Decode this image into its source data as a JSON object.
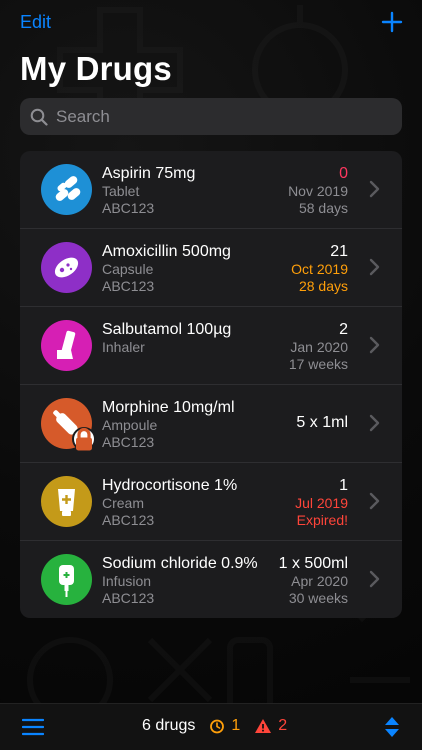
{
  "header": {
    "edit_label": "Edit",
    "title": "My Drugs"
  },
  "search": {
    "placeholder": "Search",
    "value": ""
  },
  "drugs": [
    {
      "name": "Aspirin 75mg",
      "form": "Tablet",
      "batch": "ABC123",
      "quantity": "0",
      "expiry": "Nov 2019",
      "time_left": "58 days",
      "color": "#1e90d6",
      "icon": "tablet-icon",
      "quantity_color": "#ff375f",
      "expiry_color": "#8e8e93",
      "time_left_color": "#8e8e93"
    },
    {
      "name": "Amoxicillin 500mg",
      "form": "Capsule",
      "batch": "ABC123",
      "quantity": "21",
      "expiry": "Oct 2019",
      "time_left": "28 days",
      "color": "#8e2fc7",
      "icon": "capsule-icon",
      "quantity_color": "#ffffff",
      "expiry_color": "#ff9f0a",
      "time_left_color": "#ff9f0a"
    },
    {
      "name": "Salbutamol 100µg",
      "form": "Inhaler",
      "batch": "",
      "quantity": "2",
      "expiry": "Jan 2020",
      "time_left": "17 weeks",
      "color": "#d61fb4",
      "icon": "inhaler-icon",
      "quantity_color": "#ffffff",
      "expiry_color": "#8e8e93",
      "time_left_color": "#8e8e93"
    },
    {
      "name": "Morphine 10mg/ml",
      "form": "Ampoule",
      "batch": "ABC123",
      "quantity": "5 x 1ml",
      "expiry": "",
      "time_left": "",
      "color": "#d65a2a",
      "icon": "ampoule-icon",
      "locked": true,
      "quantity_color": "#ffffff",
      "expiry_color": "#8e8e93",
      "time_left_color": "#8e8e93"
    },
    {
      "name": "Hydrocortisone 1%",
      "form": "Cream",
      "batch": "ABC123",
      "quantity": "1",
      "expiry": "Jul 2019",
      "time_left": "Expired!",
      "color": "#c49a19",
      "icon": "cream-tube-icon",
      "quantity_color": "#ffffff",
      "expiry_color": "#ff453a",
      "time_left_color": "#ff453a"
    },
    {
      "name": "Sodium chloride 0.9%",
      "form": "Infusion",
      "batch": "ABC123",
      "quantity": "1 x 500ml",
      "expiry": "Apr 2020",
      "time_left": "30 weeks",
      "color": "#27b23e",
      "icon": "infusion-bag-icon",
      "quantity_color": "#ffffff",
      "expiry_color": "#8e8e93",
      "time_left_color": "#8e8e93"
    }
  ],
  "footer": {
    "drug_count": "6 drugs",
    "expiring_count": "1",
    "expired_count": "2"
  },
  "colors": {
    "accent": "#0a84ff",
    "warning": "#ff9f0a",
    "danger": "#ff453a"
  }
}
